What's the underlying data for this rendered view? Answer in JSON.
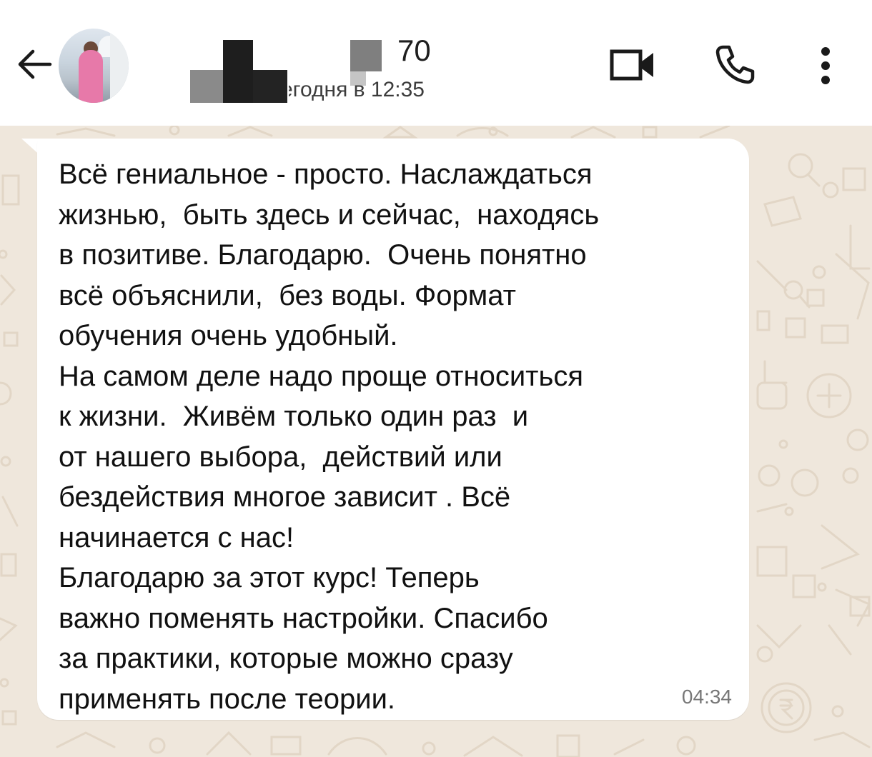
{
  "header": {
    "contact_name_visible": "70",
    "last_seen": "сегодня в 12:35",
    "icons": {
      "back": "arrow-left-icon",
      "video": "video-camera-icon",
      "call": "phone-icon",
      "menu": "more-vertical-icon"
    }
  },
  "message": {
    "text": "Всё гениальное - просто. Наслаждаться\nжизнью,  быть здесь и сейчас,  находясь\nв позитиве. Благодарю.  Очень понятно\nвсё объяснили,  без воды. Формат\nобучения очень удобный.\nНа самом деле надо проще относиться\nк жизни.  Живём только один раз  и\nот нашего выбора,  действий или\nбездействия многое зависит . Всё\nначинается с нас!\nБлагодарю за этот курс! Теперь\nважно поменять настройки. Спасибо\nза практики, которые можно сразу\nприменять после теории.",
    "time": "04:34"
  },
  "colors": {
    "header_bg": "#ffffff",
    "chat_bg": "#efe7dc",
    "bubble_bg": "#ffffff",
    "doodle": "#e2d6c6"
  }
}
